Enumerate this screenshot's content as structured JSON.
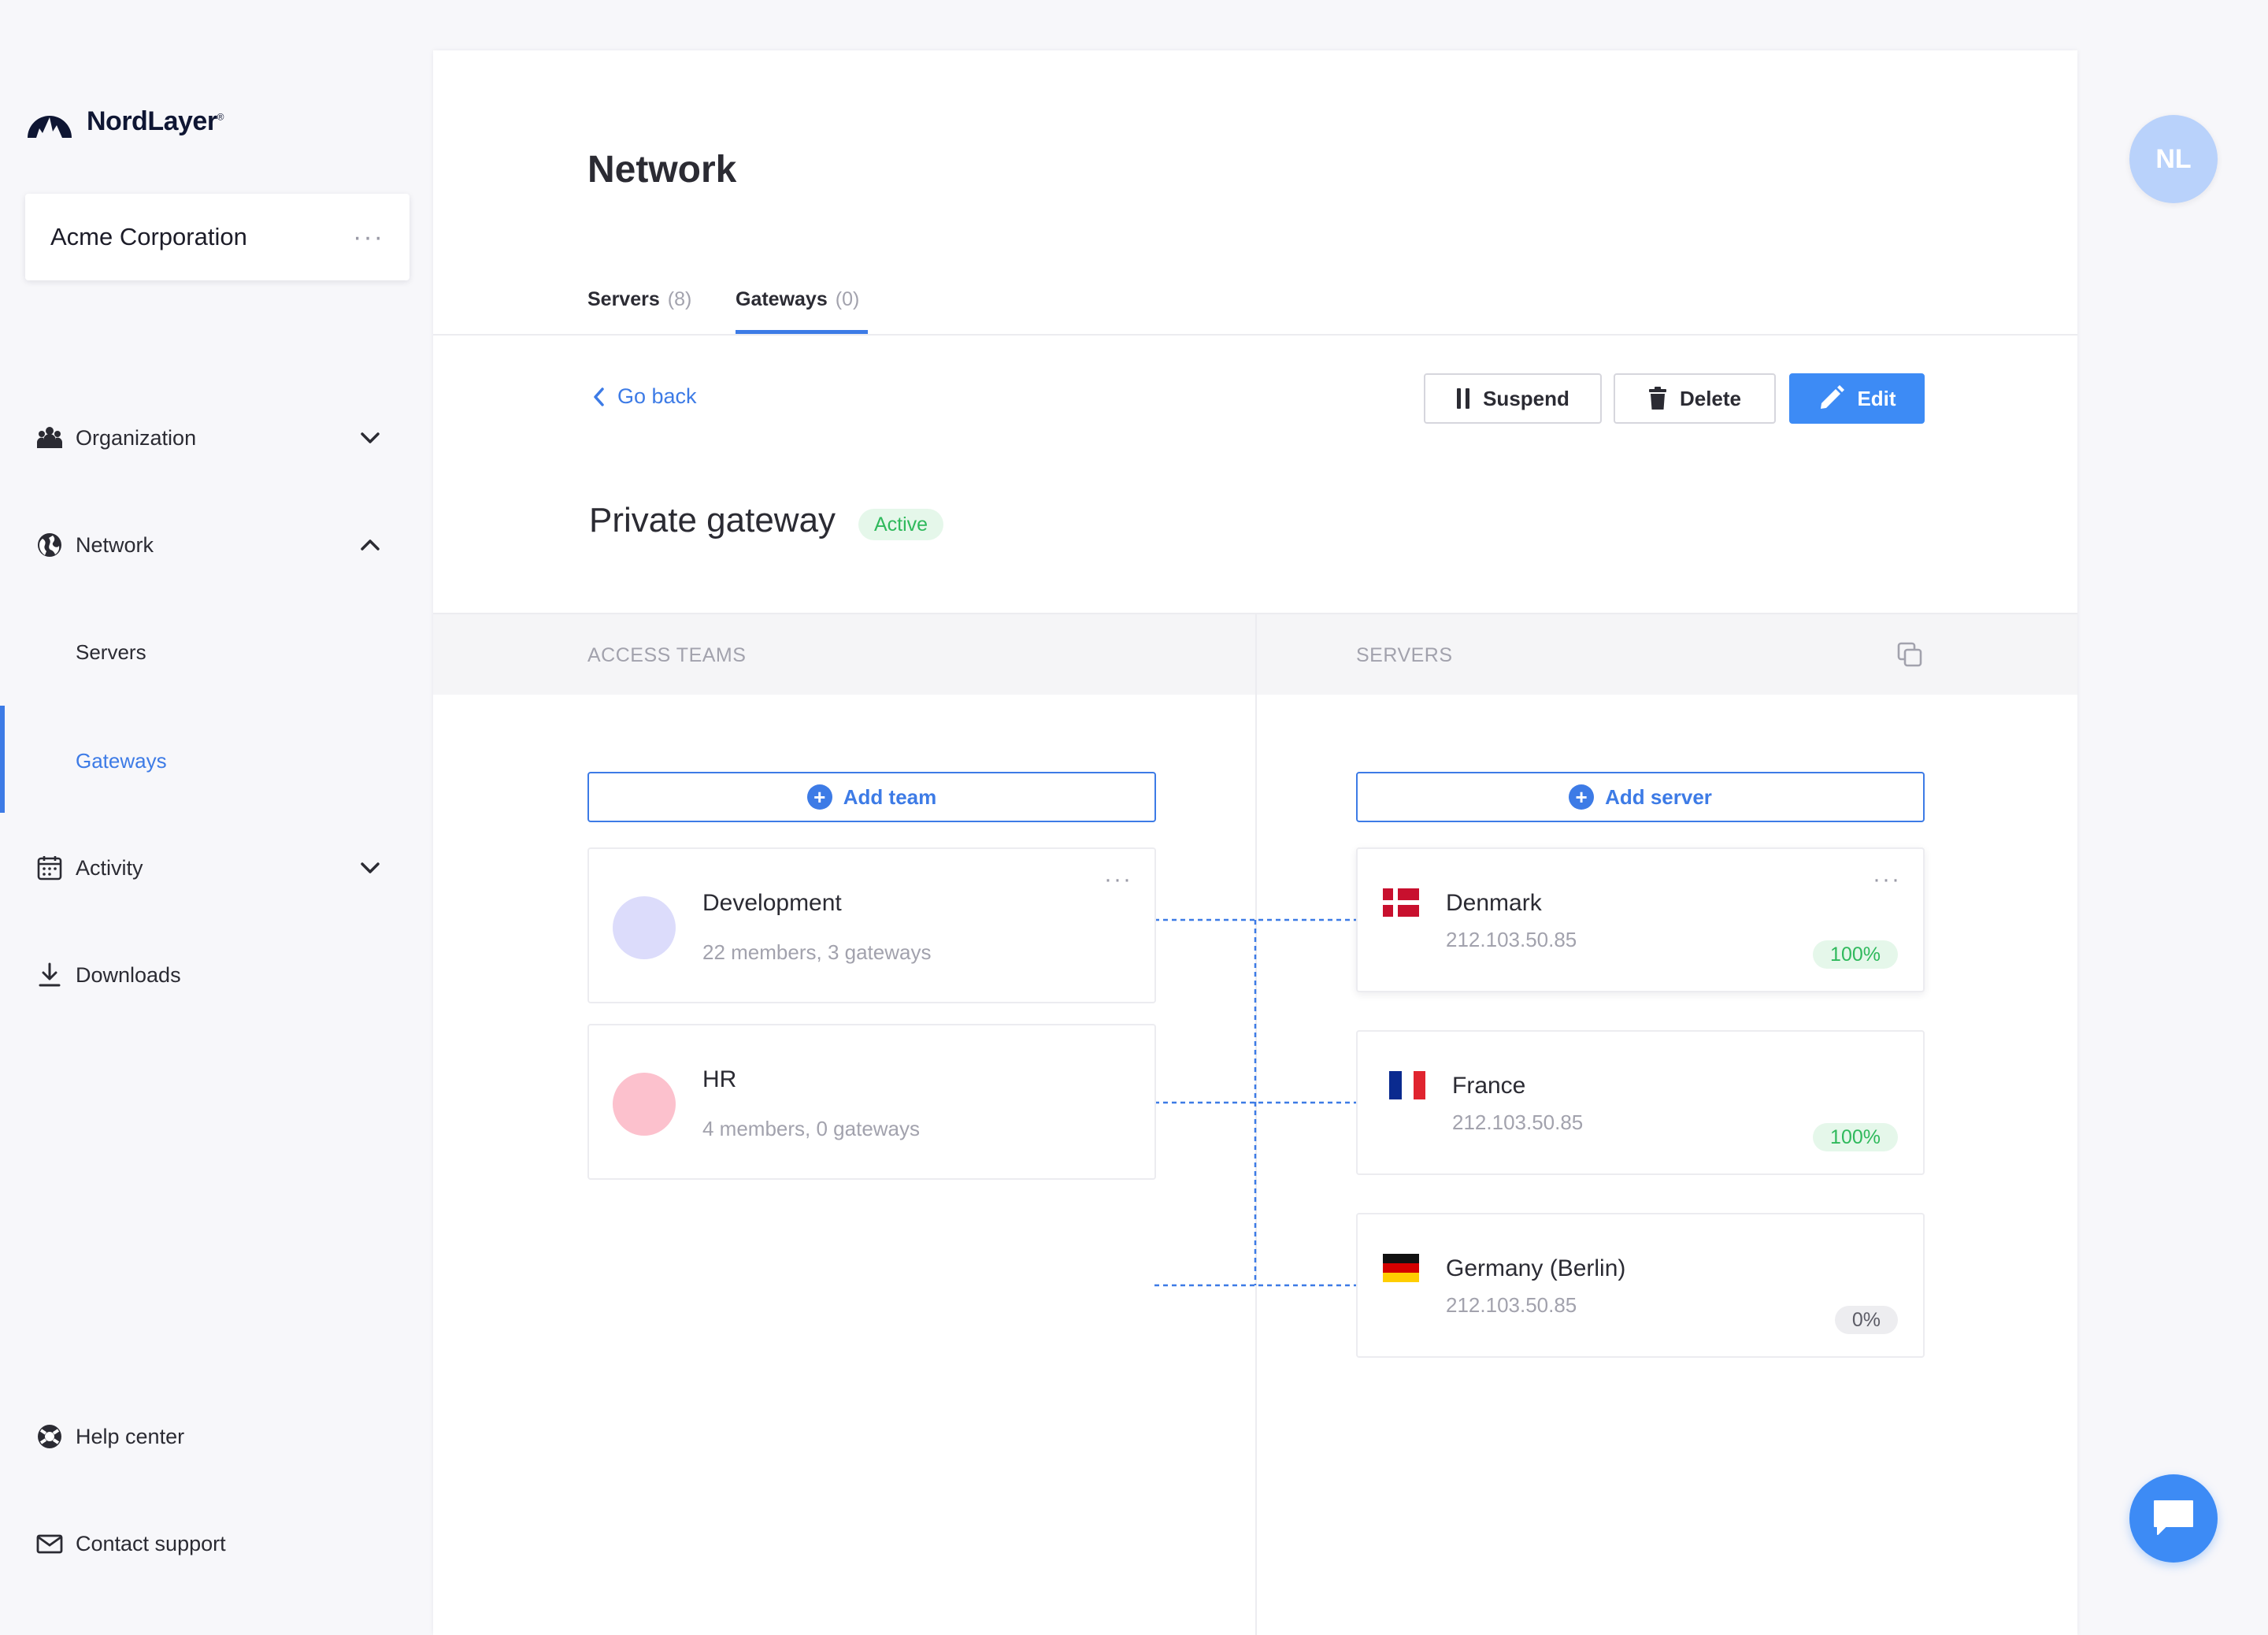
{
  "brand": {
    "name": "NordLayer",
    "mark": "®"
  },
  "org": {
    "name": "Acme Corporation"
  },
  "sidebar": {
    "items": [
      {
        "label": "Organization"
      },
      {
        "label": "Network"
      },
      {
        "label": "Servers"
      },
      {
        "label": "Gateways"
      },
      {
        "label": "Activity"
      },
      {
        "label": "Downloads"
      }
    ],
    "footer": [
      {
        "label": "Help center"
      },
      {
        "label": "Contact support"
      }
    ]
  },
  "page": {
    "title": "Network",
    "tabs": [
      {
        "label": "Servers",
        "count": "(8)"
      },
      {
        "label": "Gateways",
        "count": "(0)"
      }
    ]
  },
  "toolbar": {
    "go_back": "Go back",
    "suspend": "Suspend",
    "delete": "Delete",
    "edit": "Edit"
  },
  "gateway": {
    "name": "Private gateway",
    "status": "Active"
  },
  "columns": {
    "teams": "ACCESS TEAMS",
    "servers": "SERVERS"
  },
  "teams": {
    "add_label": "Add team",
    "list": [
      {
        "name": "Development",
        "meta": "22 members, 3 gateways",
        "color": "#dcdcfb"
      },
      {
        "name": "HR",
        "meta": "4 members, 0 gateways",
        "color": "#fcc1cd"
      }
    ]
  },
  "servers": {
    "add_label": "Add server",
    "list": [
      {
        "name": "Denmark",
        "ip": "212.103.50.85",
        "load": "100%"
      },
      {
        "name": "France",
        "ip": "212.103.50.85",
        "load": "100%"
      },
      {
        "name": "Germany (Berlin)",
        "ip": "212.103.50.85",
        "load": "0%"
      }
    ]
  },
  "user": {
    "initials": "NL"
  },
  "colors": {
    "accent": "#3d7be6",
    "primary_button": "#3d8bf5",
    "success": "#2fb95c"
  },
  "icons": {
    "logo": "nordlayer-mountain-icon",
    "org_menu": "more-dots-icon",
    "organization": "team-icon",
    "network": "globe-icon",
    "activity": "calendar-icon",
    "downloads": "download-icon",
    "help": "lifebuoy-icon",
    "contact": "mail-icon",
    "suspend": "pause-icon",
    "delete": "trash-icon",
    "edit": "pencil-icon",
    "copy": "copy-icon",
    "chat": "chat-icon"
  }
}
